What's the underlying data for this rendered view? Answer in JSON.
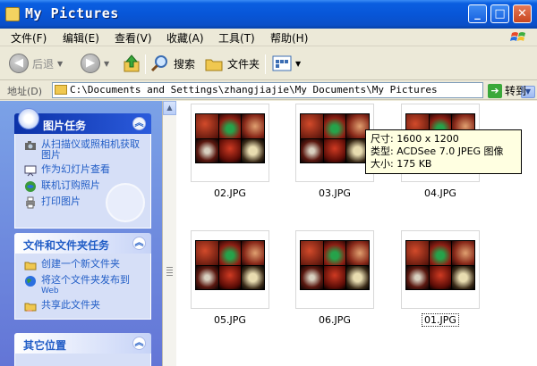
{
  "window": {
    "title": "My Pictures"
  },
  "menu": {
    "items": [
      "文件(F)",
      "编辑(E)",
      "查看(V)",
      "收藏(A)",
      "工具(T)",
      "帮助(H)"
    ]
  },
  "toolbar": {
    "back": "后退",
    "search": "搜索",
    "folders": "文件夹"
  },
  "address": {
    "label": "地址(D)",
    "path": "C:\\Documents and Settings\\zhangjiajie\\My Documents\\My Pictures",
    "go": "转到"
  },
  "taskpane": {
    "picture_tasks": {
      "title": "图片任务",
      "items": [
        {
          "label": "从扫描仪或照相机获取图片",
          "icon": "camera-icon"
        },
        {
          "label": "作为幻灯片查看",
          "icon": "slideshow-icon"
        },
        {
          "label": "联机订购照片",
          "icon": "order-prints-icon"
        },
        {
          "label": "打印图片",
          "icon": "printer-icon"
        }
      ]
    },
    "file_tasks": {
      "title": "文件和文件夹任务",
      "items": [
        {
          "label": "创建一个新文件夹",
          "sub": "",
          "icon": "new-folder-icon"
        },
        {
          "label": "将这个文件夹发布到",
          "sub": "Web",
          "icon": "publish-web-icon"
        },
        {
          "label": "共享此文件夹",
          "sub": "",
          "icon": "share-folder-icon"
        }
      ]
    },
    "other_places": {
      "title": "其它位置"
    }
  },
  "files": [
    {
      "name": "02.JPG",
      "selected": false
    },
    {
      "name": "03.JPG",
      "selected": false
    },
    {
      "name": "04.JPG",
      "selected": false
    },
    {
      "name": "05.JPG",
      "selected": false
    },
    {
      "name": "06.JPG",
      "selected": false
    },
    {
      "name": "01.JPG",
      "selected": true
    }
  ],
  "tooltip": {
    "size": "尺寸: 1600 x 1200",
    "type": "类型: ACDSee 7.0 JPEG 图像",
    "filesize": "大小: 175 KB"
  },
  "colors": {
    "title_bar": "#0856d8",
    "task_pane": "#7ba2e7",
    "link": "#215dc6"
  }
}
